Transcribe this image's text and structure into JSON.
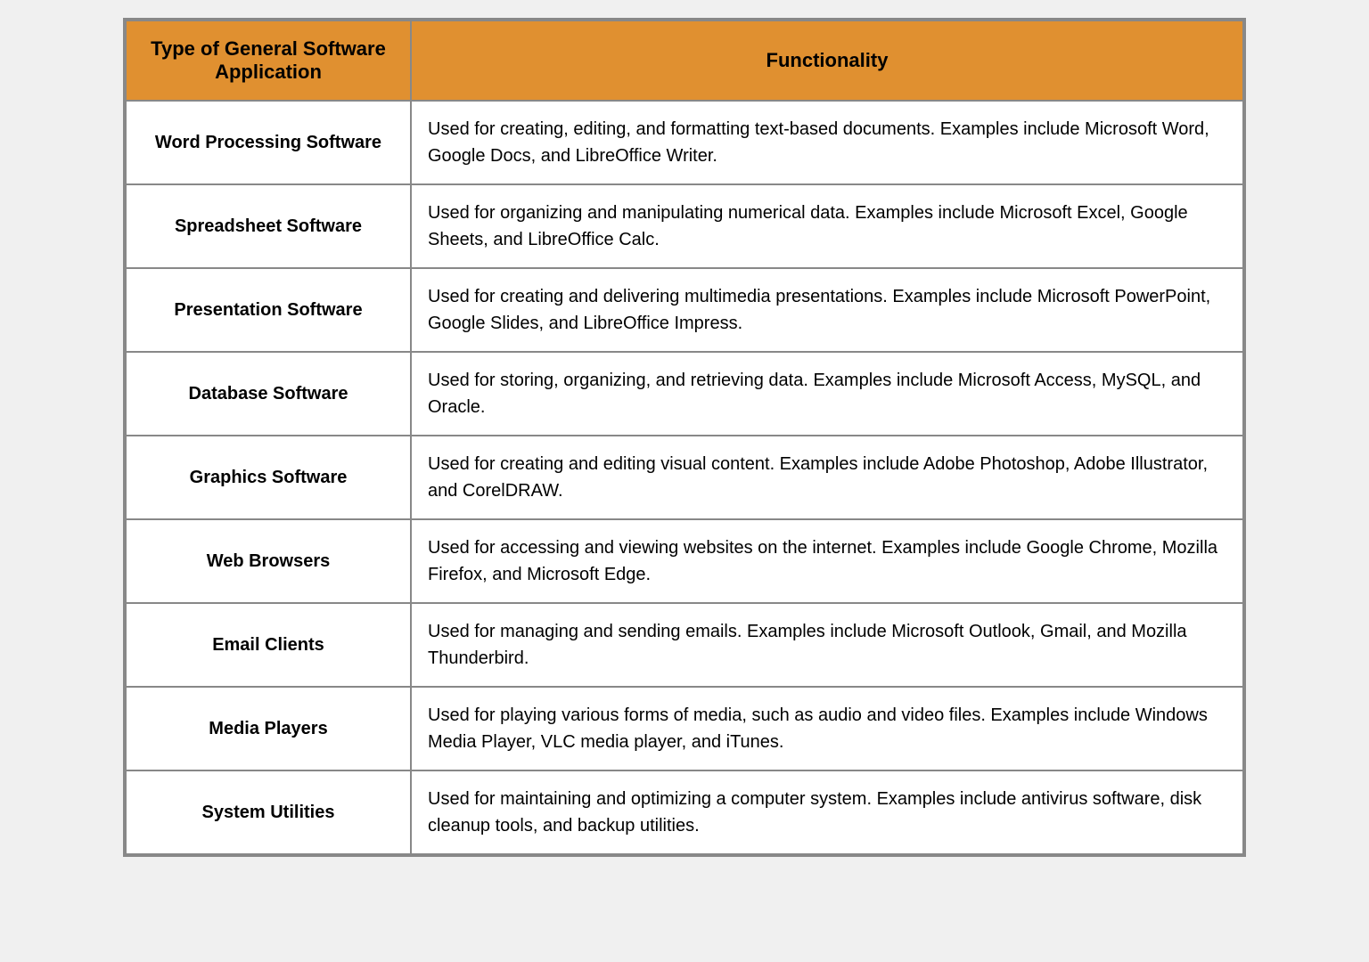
{
  "header": {
    "col1": "Type of General Software Application",
    "col2": "Functionality",
    "accent_color": "#E09030"
  },
  "rows": [
    {
      "type": "Word Processing Software",
      "functionality": "Used for creating, editing, and formatting text-based documents. Examples include Microsoft Word, Google Docs, and LibreOffice Writer."
    },
    {
      "type": "Spreadsheet Software",
      "functionality": "Used for organizing and manipulating numerical data. Examples include Microsoft Excel, Google Sheets, and LibreOffice Calc."
    },
    {
      "type": "Presentation Software",
      "functionality": "Used for creating and delivering multimedia presentations. Examples include Microsoft PowerPoint, Google Slides, and LibreOffice Impress."
    },
    {
      "type": "Database Software",
      "functionality": "Used for storing, organizing, and retrieving data. Examples include Microsoft Access, MySQL, and Oracle."
    },
    {
      "type": "Graphics Software",
      "functionality": "Used for creating and editing visual content. Examples include Adobe Photoshop, Adobe Illustrator, and CorelDRAW."
    },
    {
      "type": "Web Browsers",
      "functionality": "Used for accessing and viewing websites on the internet. Examples include Google Chrome, Mozilla Firefox, and Microsoft Edge."
    },
    {
      "type": "Email Clients",
      "functionality": "Used for managing and sending emails. Examples include Microsoft Outlook, Gmail, and Mozilla Thunderbird."
    },
    {
      "type": "Media Players",
      "functionality": "Used for playing various forms of media, such as audio and video files. Examples include Windows Media Player, VLC media player, and iTunes."
    },
    {
      "type": "System Utilities",
      "functionality": "Used for maintaining and optimizing a computer system. Examples include antivirus software, disk cleanup tools, and backup utilities."
    }
  ]
}
